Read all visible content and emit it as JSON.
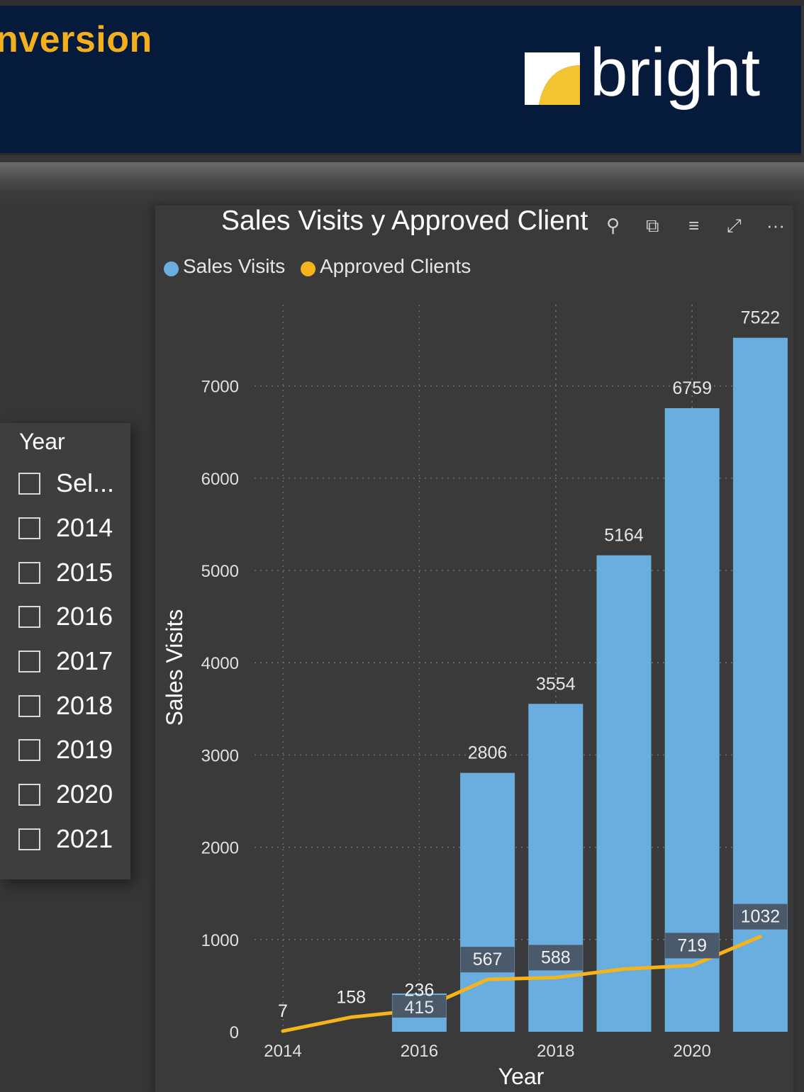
{
  "header": {
    "title_fragment": "nversion",
    "logo_text": "bright",
    "colors": {
      "banner": "#061a3b",
      "title": "#f2b01e",
      "logo_mark_yellow": "#f4c430",
      "logo_mark_white": "#ffffff"
    }
  },
  "slicer": {
    "title": "Year",
    "items": [
      {
        "label": "Sel...",
        "checked": false
      },
      {
        "label": "2014",
        "checked": false
      },
      {
        "label": "2015",
        "checked": false
      },
      {
        "label": "2016",
        "checked": false
      },
      {
        "label": "2017",
        "checked": false
      },
      {
        "label": "2018",
        "checked": false
      },
      {
        "label": "2019",
        "checked": false
      },
      {
        "label": "2020",
        "checked": false
      },
      {
        "label": "2021",
        "checked": false
      }
    ]
  },
  "visual": {
    "title": "Sales Visits y Approved Client",
    "toolbar": [
      {
        "icon": "pin-icon",
        "glyph": "⚲"
      },
      {
        "icon": "copy-icon",
        "glyph": "⧉"
      },
      {
        "icon": "filter-icon",
        "glyph": "≡"
      },
      {
        "icon": "focus-mode-icon",
        "glyph": "⤢"
      },
      {
        "icon": "more-options-icon",
        "glyph": "···"
      }
    ],
    "legend": [
      {
        "label": "Sales Visits",
        "color": "#6aaddf"
      },
      {
        "label": "Approved Clients",
        "color": "#f5b41a"
      }
    ]
  },
  "chart_data": {
    "type": "bar",
    "title": "Sales Visits y Approved Client",
    "xlabel": "Year",
    "ylabel": "Sales Visits",
    "ylim": [
      0,
      7700
    ],
    "y_ticks": [
      0,
      1000,
      2000,
      3000,
      4000,
      5000,
      6000,
      7000
    ],
    "x_tick_labels": [
      "2014",
      "2016",
      "2018",
      "2020"
    ],
    "categories": [
      2014,
      2015,
      2016,
      2017,
      2018,
      2019,
      2020,
      2021
    ],
    "grid": true,
    "legend_position": "top-left",
    "series": [
      {
        "name": "Sales Visits",
        "type": "bar",
        "color": "#6aaddf",
        "values": [
          null,
          null,
          415,
          2806,
          3554,
          5164,
          6759,
          7522
        ],
        "labels": [
          "",
          "",
          "415",
          "2806",
          "3554",
          "5164",
          "6759",
          "7522"
        ]
      },
      {
        "name": "Approved Clients",
        "type": "line",
        "color": "#f5b41a",
        "values": [
          7,
          158,
          236,
          567,
          588,
          680,
          719,
          1032
        ],
        "labels": [
          "7",
          "158",
          "236",
          "567",
          "588",
          "",
          "719",
          "1032"
        ]
      }
    ]
  }
}
